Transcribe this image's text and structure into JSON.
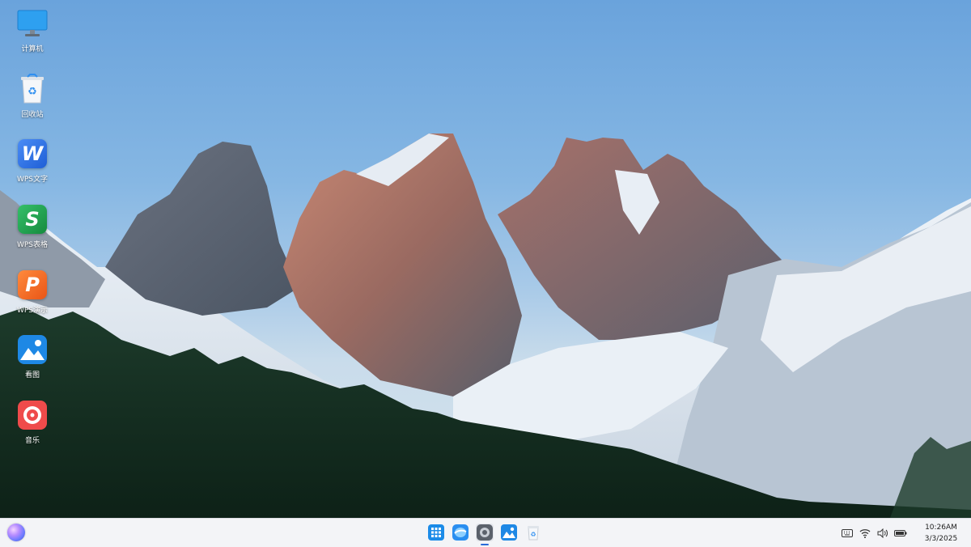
{
  "desktop": {
    "icons": [
      {
        "label": "计算机",
        "icon": "computer-icon"
      },
      {
        "label": "回收站",
        "icon": "recycle-bin-icon"
      },
      {
        "label": "WPS文字",
        "icon": "wps-writer-icon",
        "glyph": "W",
        "color": "#2b6fe3"
      },
      {
        "label": "WPS表格",
        "icon": "wps-spreadsheet-icon",
        "glyph": "S",
        "color": "#1f9e49"
      },
      {
        "label": "WPS演示",
        "icon": "wps-presentation-icon",
        "glyph": "P",
        "color": "#f06a23"
      },
      {
        "label": "看图",
        "icon": "image-viewer-icon",
        "color": "#1e88e5"
      },
      {
        "label": "音乐",
        "icon": "music-icon",
        "color": "#ef4b4b"
      }
    ]
  },
  "taskbar": {
    "start": {
      "icon": "start-orb-icon"
    },
    "apps": [
      {
        "name": "app-launcher",
        "icon": "grid-apps-icon",
        "color": "#1b8be8"
      },
      {
        "name": "browser",
        "icon": "browser-icon",
        "color": "#2a8ef0"
      },
      {
        "name": "settings",
        "icon": "settings-icon",
        "active": true
      },
      {
        "name": "image-viewer",
        "icon": "image-viewer-icon",
        "color": "#1e88e5"
      },
      {
        "name": "recycle-bin",
        "icon": "recycle-bin-icon"
      }
    ],
    "tray": {
      "icons": [
        "keyboard-icon",
        "wifi-icon",
        "volume-icon",
        "battery-icon"
      ],
      "time": "10:26AM",
      "date": "3/3/2025"
    }
  }
}
